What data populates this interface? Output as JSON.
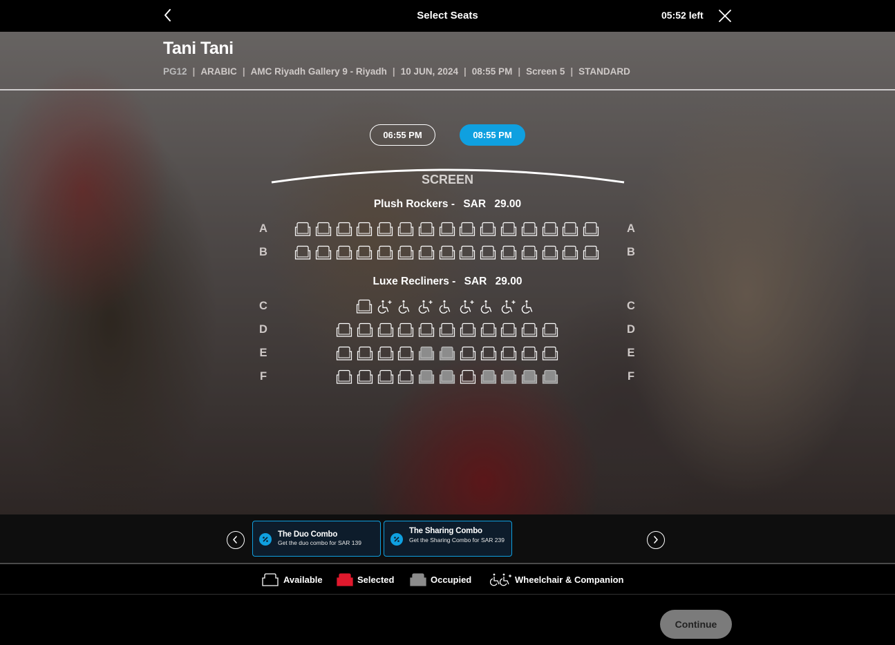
{
  "header": {
    "title": "Select Seats",
    "timer": "05:52 left"
  },
  "film": {
    "title": "Tani Tani",
    "rating": "PG12",
    "language": "ARABIC",
    "cinema": "AMC Riyadh Gallery 9 - Riyadh",
    "date": "10 JUN, 2024",
    "time": "08:55 PM",
    "screen": "Screen 5",
    "format": "STANDARD"
  },
  "showtimes": [
    {
      "label": "06:55 PM",
      "selected": false
    },
    {
      "label": "08:55 PM",
      "selected": true
    }
  ],
  "screen_label": "SCREEN",
  "sections": [
    {
      "name": "Plush Rockers -",
      "currency": "SAR",
      "price": "29.00"
    },
    {
      "name": "Luxe Recliners -",
      "currency": "SAR",
      "price": "29.00"
    }
  ],
  "rows": [
    "A",
    "B",
    "C",
    "D",
    "E",
    "F"
  ],
  "seat_map": {
    "A": "AAAAAAAAAAAAAAA",
    "B": "AAAAAAAAAAAAAAA",
    "C": "AWWWWWWWW",
    "D": "AAAAAAAAAAA",
    "E": "AAAAOOAAAAA",
    "F": "AAAAOOAOOOO"
  },
  "seat_legend_codes": {
    "A": "Available",
    "O": "Occupied",
    "W": "Wheelchair & Companion"
  },
  "offers": [
    {
      "name": "The Duo Combo",
      "description": "Get the duo combo for SAR 139"
    },
    {
      "name": "The Sharing Combo",
      "description": "Get the Sharing Combo for SAR 239"
    }
  ],
  "legend": {
    "available": "Available",
    "selected": "Selected",
    "occupied": "Occupied",
    "wheelchair": "Wheelchair & Companion"
  },
  "colors": {
    "accent": "#0fa0e0",
    "selected_seat": "#e0192d",
    "occupied_seat": "#8c8c8c"
  },
  "continue_label": "Continue"
}
